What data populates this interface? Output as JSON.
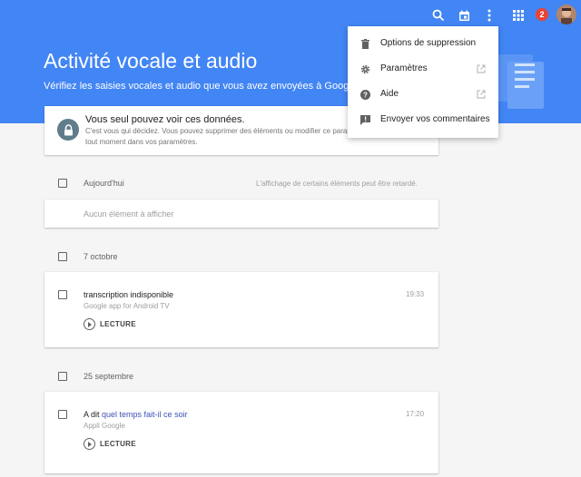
{
  "header": {
    "title": "Activité vocale et audio",
    "subtitle": "Vérifiez les saisies vocales et audio que vous avez envoyées à Google.",
    "notification_count": "2",
    "accent_color": "#4285f4"
  },
  "topbar": {
    "icons": [
      "search-icon",
      "calendar-icon",
      "more-vert-icon",
      "apps-grid-icon"
    ]
  },
  "privacy": {
    "title": "Vous seul pouvez voir ces données.",
    "description": "C'est vous qui décidez. Vous pouvez supprimer des éléments ou modifier ce paramètre à tout moment dans vos paramètres."
  },
  "menu": {
    "items": [
      {
        "label": "Options de suppression",
        "icon": "trash-icon"
      },
      {
        "label": "Paramètres",
        "icon": "gear-icon"
      },
      {
        "label": "Aide",
        "icon": "help-icon"
      },
      {
        "label": "Envoyer vos commentaires",
        "icon": "feedback-icon"
      }
    ]
  },
  "today": {
    "label": "Aujourd'hui",
    "notice": "L'affichage de certains éléments peut être retardé.",
    "empty": "Aucun élément à afficher"
  },
  "groups": [
    {
      "date": "7 octobre",
      "item": {
        "title": "transcription indisponible",
        "source": "Google app for Android TV",
        "time": "19:33",
        "action": "LECTURE"
      }
    },
    {
      "date": "25 septembre",
      "item": {
        "prefix": "A dit",
        "query": "quel temps fait-il ce soir",
        "source": "Appli Google",
        "time": "17:20",
        "action": "LECTURE"
      }
    }
  ]
}
